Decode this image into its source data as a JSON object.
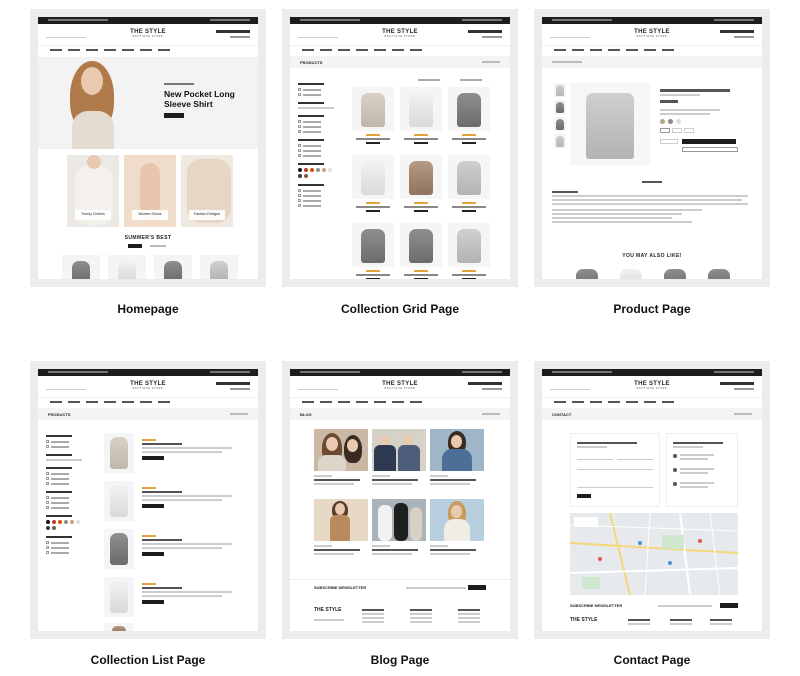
{
  "pages": [
    {
      "id": "homepage",
      "caption": "Homepage"
    },
    {
      "id": "collection-grid",
      "caption": "Collection Grid Page"
    },
    {
      "id": "product",
      "caption": "Product Page"
    },
    {
      "id": "collection-list",
      "caption": "Collection List Page"
    },
    {
      "id": "blog",
      "caption": "Blog Page"
    },
    {
      "id": "contact",
      "caption": "Contact Page"
    }
  ],
  "site": {
    "logo": "THE STYLE",
    "logo_tagline": "BOUTIQUE STORE"
  },
  "homepage": {
    "hero_title": "New Pocket Long Sleeve Shirt",
    "categories": [
      "Trendy Clothes",
      "Women Shoes",
      "Fashion Designs"
    ],
    "section_title": "SUMMER'S BEST"
  },
  "collection_grid": {
    "heading": "PRODUCTS"
  },
  "product": {
    "section_title": "YOU MAY ALSO LIKE!"
  },
  "collection_list": {
    "heading": "PRODUCTS"
  },
  "blog": {
    "heading": "BLOG",
    "newsletter": "SUBSCRIBE NEWSLETTER"
  },
  "contact": {
    "heading": "CONTACT",
    "newsletter": "SUBSCRIBE NEWSLETTER"
  },
  "colors": {
    "card_bg": "#ececec",
    "topbar": "#1d1d1d",
    "accent_stars": "#e4a23a"
  }
}
